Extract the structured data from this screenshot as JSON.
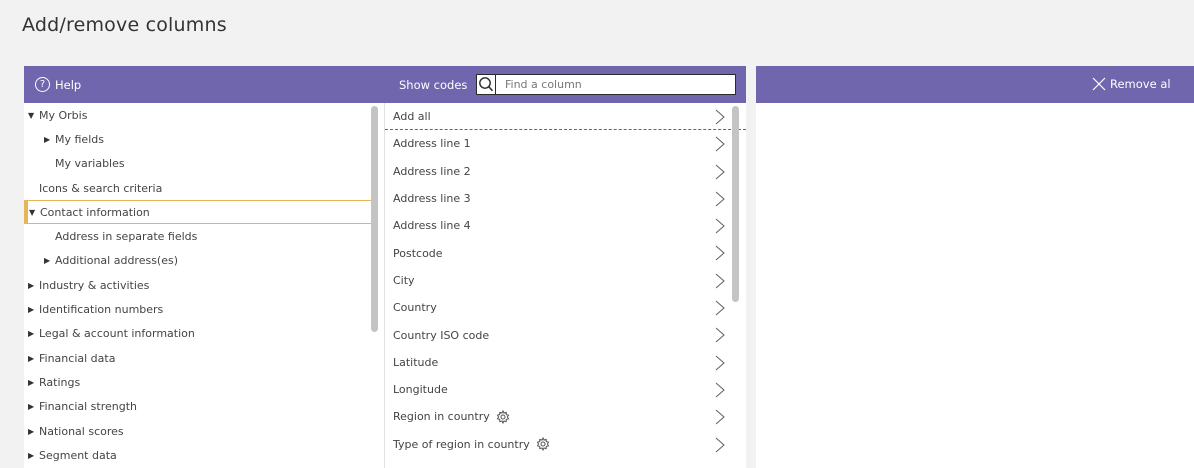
{
  "page_title": "Add/remove columns",
  "toolbar": {
    "help_label": "Help",
    "show_codes_label": "Show codes",
    "search_placeholder": "Find a column",
    "remove_all_label": "Remove al"
  },
  "tree": [
    {
      "label": "My Orbis",
      "level": 0,
      "state": "expanded"
    },
    {
      "label": "My fields",
      "level": 1,
      "state": "collapsed"
    },
    {
      "label": "My variables",
      "level": 1,
      "state": "leaf"
    },
    {
      "label": "Icons & search criteria",
      "level": 0,
      "state": "leaf"
    },
    {
      "label": "Contact information",
      "level": 0,
      "state": "expanded",
      "selected": true
    },
    {
      "label": "Address in separate fields",
      "level": 1,
      "state": "leaf"
    },
    {
      "label": "Additional address(es)",
      "level": 1,
      "state": "collapsed"
    },
    {
      "label": "Industry & activities",
      "level": 0,
      "state": "collapsed"
    },
    {
      "label": "Identification numbers",
      "level": 0,
      "state": "collapsed"
    },
    {
      "label": "Legal & account information",
      "level": 0,
      "state": "collapsed"
    },
    {
      "label": "Financial data",
      "level": 0,
      "state": "collapsed"
    },
    {
      "label": "Ratings",
      "level": 0,
      "state": "collapsed"
    },
    {
      "label": "Financial strength",
      "level": 0,
      "state": "collapsed"
    },
    {
      "label": "National scores",
      "level": 0,
      "state": "collapsed"
    },
    {
      "label": "Segment data",
      "level": 0,
      "state": "collapsed"
    }
  ],
  "fields": [
    {
      "label": "Add all",
      "gear": false
    },
    {
      "label": "Address line 1",
      "gear": false
    },
    {
      "label": "Address line 2",
      "gear": false
    },
    {
      "label": "Address line 3",
      "gear": false
    },
    {
      "label": "Address line 4",
      "gear": false
    },
    {
      "label": "Postcode",
      "gear": false
    },
    {
      "label": "City",
      "gear": false
    },
    {
      "label": "Country",
      "gear": false
    },
    {
      "label": "Country ISO code",
      "gear": false
    },
    {
      "label": "Latitude",
      "gear": false
    },
    {
      "label": "Longitude",
      "gear": false
    },
    {
      "label": "Region in country",
      "gear": true
    },
    {
      "label": "Type of region in country",
      "gear": true
    }
  ],
  "colors": {
    "header_bar": "#6f66ad",
    "selected_border": "#e4b75a"
  }
}
